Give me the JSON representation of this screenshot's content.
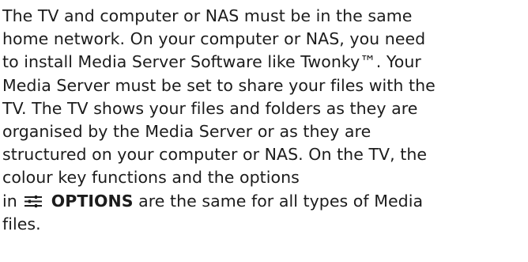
{
  "paragraph": {
    "lines": [
      "The TV and computer or NAS must be in the same",
      "home network. On your computer or NAS, you need",
      "to install Media Server Software like Twonky™. Your",
      "Media Server must be set to share your files with the",
      "TV. The TV shows your files and folders as they are",
      "organised by the Media Server or as they are",
      "structured on your computer or NAS. On the TV, the",
      "colour key functions and the options"
    ],
    "line9_prefix": "in",
    "options_icon": "options-sliders-icon",
    "options_label": "OPTIONS",
    "line9_suffix": " are the same for all types of Media",
    "line10": "files."
  }
}
